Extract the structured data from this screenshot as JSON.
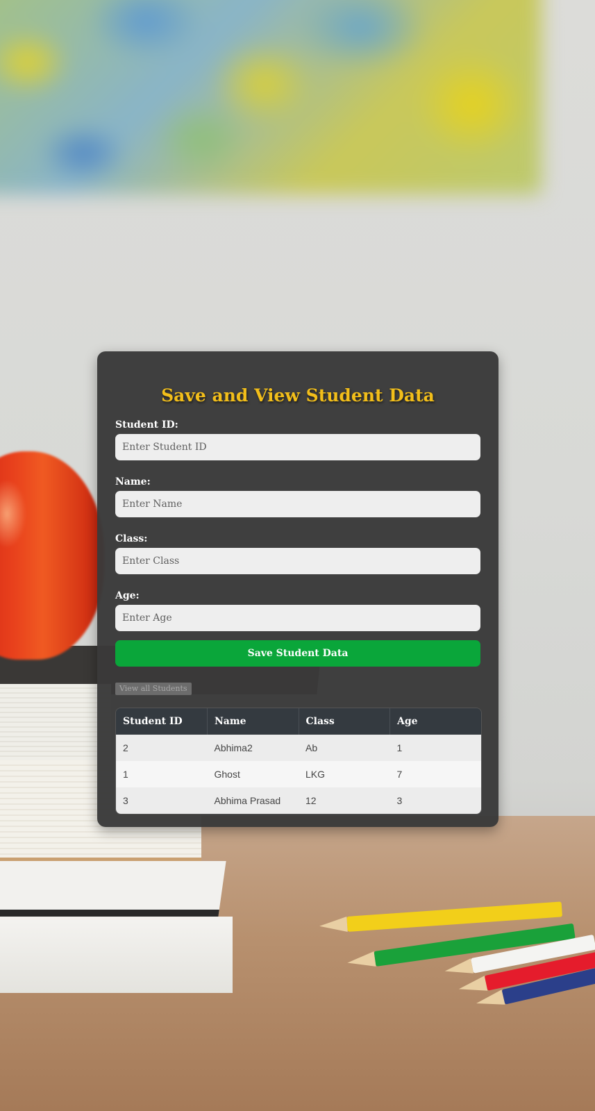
{
  "page": {
    "title": "Save and View Student Data"
  },
  "form": {
    "fields": [
      {
        "label": "Student ID:",
        "placeholder": "Enter Student ID"
      },
      {
        "label": "Name:",
        "placeholder": "Enter Name"
      },
      {
        "label": "Class:",
        "placeholder": "Enter Class"
      },
      {
        "label": "Age:",
        "placeholder": "Enter Age"
      }
    ],
    "save_label": "Save Student Data",
    "view_all_label": "View all Students"
  },
  "table": {
    "headers": [
      "Student ID",
      "Name",
      "Class",
      "Age"
    ],
    "rows": [
      [
        "2",
        "Abhima2",
        "Ab",
        "1"
      ],
      [
        "1",
        "Ghost",
        "LKG",
        "7"
      ],
      [
        "3",
        "Abhima Prasad",
        "12",
        "3"
      ]
    ]
  },
  "colors": {
    "title": "#f2be1a",
    "save_button": "#0aa63a",
    "card_background": "#3a3a3a",
    "table_header": "#343a40"
  }
}
